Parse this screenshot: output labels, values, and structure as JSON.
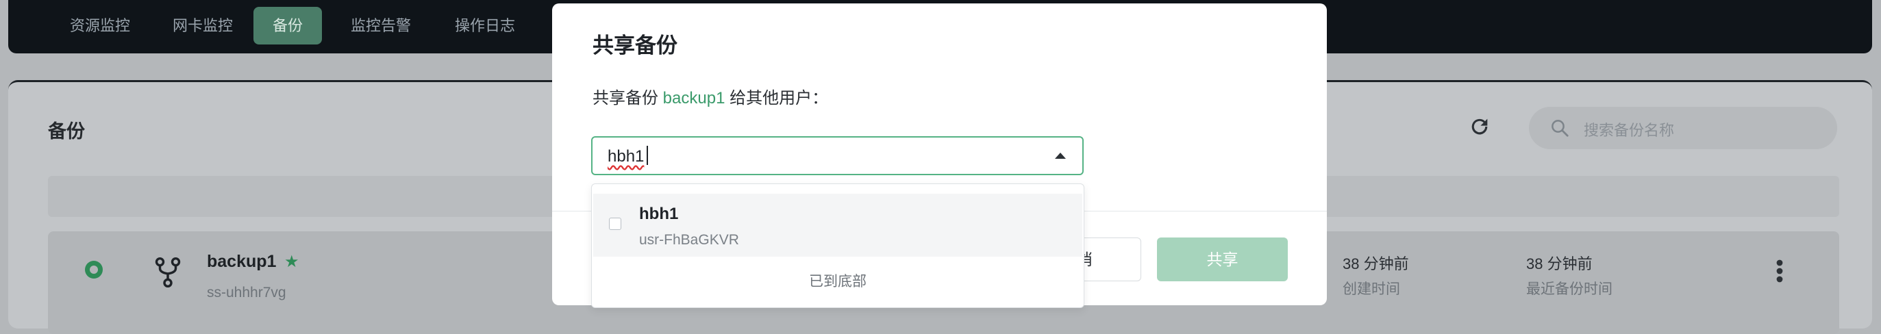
{
  "nav": {
    "items": [
      {
        "label": "资源监控",
        "active": false
      },
      {
        "label": "网卡监控",
        "active": false
      },
      {
        "label": "备份",
        "active": true
      },
      {
        "label": "监控告警",
        "active": false
      },
      {
        "label": "操作日志",
        "active": false
      }
    ]
  },
  "panel": {
    "title": "备份",
    "search_placeholder": "搜索备份名称"
  },
  "row": {
    "name": "backup1",
    "star": "★",
    "id": "ss-uhhhr7vg",
    "created_value": "38 分钟前",
    "created_label": "创建时间",
    "last_backup_value": "38 分钟前",
    "last_backup_label": "最近备份时间"
  },
  "modal": {
    "title": "共享备份",
    "desc_prefix": "共享备份",
    "desc_backup": "backup1",
    "desc_suffix": "给其他用户：",
    "select_value": "hbh1",
    "cancel_label": "消",
    "share_label": "共享"
  },
  "dropdown": {
    "options": [
      {
        "name": "hbh1",
        "id": "usr-FhBaGKVR",
        "checked": false
      }
    ],
    "footer": "已到底部"
  },
  "colors": {
    "accent": "#3a9a6a",
    "share_button_disabled": "#a6d4bc",
    "nav_active": "#4a7d68"
  }
}
